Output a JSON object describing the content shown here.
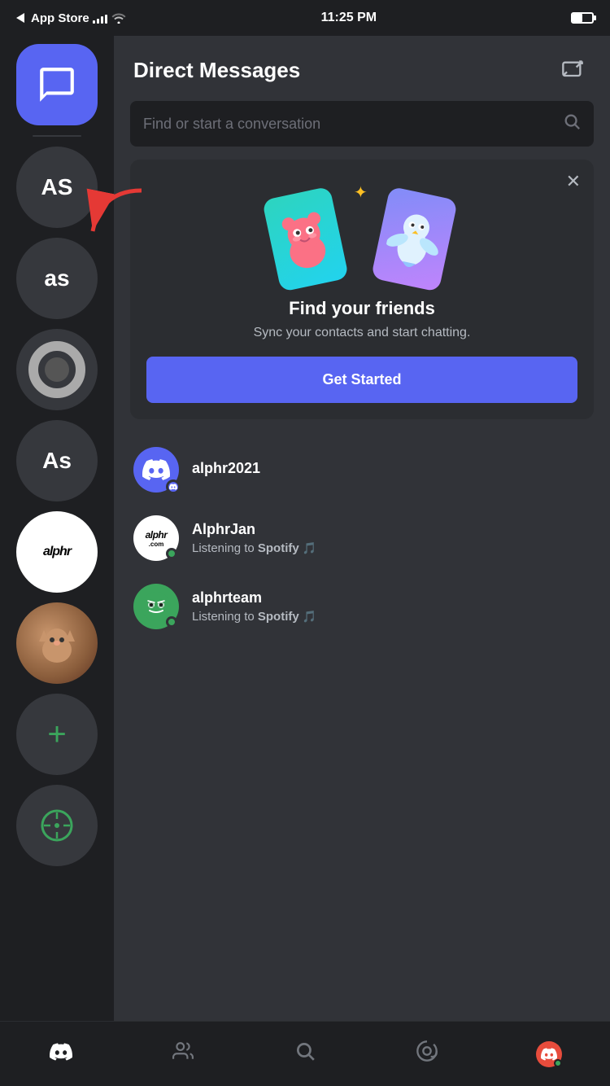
{
  "statusBar": {
    "carrier": "App Store",
    "time": "11:25 PM",
    "signal": [
      3,
      5,
      7,
      9,
      11
    ],
    "wifi": "wifi",
    "battery": 50
  },
  "sidebar": {
    "dmLabel": "DM",
    "servers": [
      {
        "id": "as-upper",
        "label": "AS",
        "type": "text",
        "bg": "#36383d"
      },
      {
        "id": "as-lower",
        "label": "as",
        "type": "text",
        "bg": "#36383d"
      },
      {
        "id": "ring",
        "label": "",
        "type": "ring",
        "bg": "#36383d"
      },
      {
        "id": "as-cap",
        "label": "As",
        "type": "text",
        "bg": "#36383d"
      },
      {
        "id": "alphr",
        "label": "alphr",
        "type": "alphr",
        "bg": "#fff"
      },
      {
        "id": "cat",
        "label": "",
        "type": "cat",
        "bg": "#8b6355"
      }
    ],
    "addServerLabel": "+",
    "discoverLabel": "discover"
  },
  "content": {
    "title": "Direct Messages",
    "newDmAriaLabel": "New Direct Message",
    "search": {
      "placeholder": "Find or start a conversation"
    },
    "findFriendsCard": {
      "title": "Find your friends",
      "subtitle": "Sync your contacts and start chatting.",
      "ctaLabel": "Get Started",
      "closeAriaLabel": "Close"
    },
    "conversations": [
      {
        "id": "alphr2021",
        "name": "alphr2021",
        "avatarType": "discord",
        "status": "",
        "statusType": "none"
      },
      {
        "id": "alphrjan",
        "name": "AlphrJan",
        "avatarType": "alphr",
        "status": "Listening to Spotify",
        "statusBold": "Spotify",
        "statusType": "music"
      },
      {
        "id": "alphrteam",
        "name": "alphrteam",
        "avatarType": "alphrteam",
        "status": "Listening to Spotify",
        "statusBold": "Spotify",
        "statusType": "music"
      }
    ]
  },
  "bottomNav": {
    "items": [
      {
        "id": "home",
        "label": "Home",
        "icon": "discord",
        "active": true
      },
      {
        "id": "friends",
        "label": "Friends",
        "icon": "friends",
        "active": false
      },
      {
        "id": "search",
        "label": "Search",
        "icon": "search",
        "active": false
      },
      {
        "id": "mentions",
        "label": "Mentions",
        "icon": "mentions",
        "active": false
      },
      {
        "id": "profile",
        "label": "Profile",
        "icon": "profile",
        "active": false
      }
    ]
  }
}
